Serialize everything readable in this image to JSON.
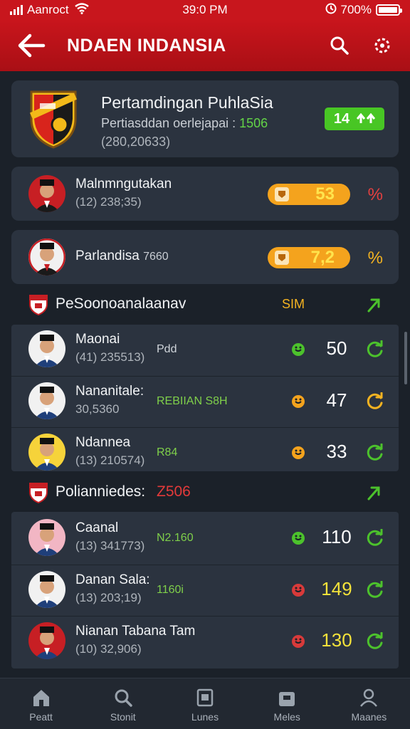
{
  "status_bar": {
    "carrier": "Aanroct",
    "time": "39:0 PM",
    "battery": "700%",
    "battery_level": 1.0
  },
  "app_bar": {
    "title": "NDAEN INDANSIA",
    "back_icon": "back-arrow-icon",
    "search_icon": "search-icon",
    "settings_icon": "settings-icon"
  },
  "hero": {
    "title": "Pertamdingan PuhlaSia",
    "subtitle": "Pertiasddan oerlejapai : ",
    "subtitle_value": "1506",
    "meta": "(280,20633)",
    "badge_value": "14",
    "badge_icon": "up-arrows-icon",
    "colors": {
      "badge": "#48c624"
    }
  },
  "highlights": [
    {
      "name": "Malnmngutakan",
      "meta": "(12) 238;35)",
      "value": "53",
      "suffix": "%"
    },
    {
      "name": "Parlandisa",
      "name_extra": "7660",
      "meta": "",
      "value": "7,2",
      "suffix": "%"
    }
  ],
  "sections": [
    {
      "title": "PeSoonoanalaanav",
      "code": "SIM",
      "rows": [
        {
          "name": "Maonai",
          "meta": "(41) 235513)",
          "tag": "Pdd",
          "tag_color": "#cfd4da",
          "icon_color": "#4cc22c",
          "value": "50",
          "value_color": "#ffffff",
          "action_color": "#4cc22c"
        },
        {
          "name": "Nananitale:",
          "meta": "30,5360",
          "tag": "REBIIAN S8H",
          "tag_color": "#7fd04a",
          "icon_color": "#f4a31d",
          "value": "47",
          "value_color": "#ffffff",
          "action_color": "#f4b321"
        },
        {
          "name": "Ndannea",
          "meta": "(13) 210574)",
          "tag": "R84",
          "tag_color": "#7fd04a",
          "icon_color": "#f4a31d",
          "value": "33",
          "value_color": "#ffffff",
          "action_color": "#4cc22c"
        }
      ]
    },
    {
      "title": "Polianniedes:",
      "code": "Z506",
      "rows": [
        {
          "name": "Caanal",
          "meta": "(13) 341773)",
          "tag": "N2.160",
          "tag_color": "#7fd04a",
          "icon_color": "#4cc22c",
          "value": "110",
          "value_color": "#ffffff",
          "action_color": "#4cc22c"
        },
        {
          "name": "Danan Sala:",
          "meta": "(13) 203;19)",
          "tag": "1160i",
          "tag_color": "#7fd04a",
          "icon_color": "#d83a3a",
          "value": "149",
          "value_color": "#f3e23a",
          "action_color": "#4cc22c"
        },
        {
          "name": "Nianan Tabana Tam",
          "meta": "(10) 32,906)",
          "tag": "",
          "tag_color": "#7fd04a",
          "icon_color": "#d83a3a",
          "value": "130",
          "value_color": "#f3e23a",
          "action_color": "#4cc22c"
        }
      ]
    }
  ],
  "tabs": [
    {
      "label": "Peatt",
      "icon": "home-icon"
    },
    {
      "label": "Stonit",
      "icon": "search-icon"
    },
    {
      "label": "Lunes",
      "icon": "schedule-icon"
    },
    {
      "label": "Meles",
      "icon": "bag-icon"
    },
    {
      "label": "Maanes",
      "icon": "profile-icon"
    }
  ]
}
